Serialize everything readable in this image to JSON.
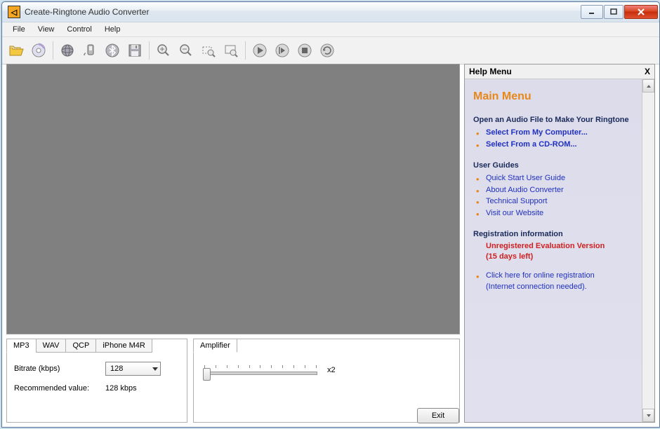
{
  "titlebar": {
    "title": "Create-Ringtone Audio Converter"
  },
  "menu": {
    "file": "File",
    "view": "View",
    "control": "Control",
    "help": "Help"
  },
  "tabs": {
    "mp3": "MP3",
    "wav": "WAV",
    "qcp": "QCP",
    "m4r": "iPhone M4R"
  },
  "bitrate": {
    "label": "Bitrate (kbps)",
    "value": "128",
    "rec_label": "Recommended value:",
    "rec_value": "128 kbps"
  },
  "amplifier": {
    "title": "Amplifier",
    "value": "x2"
  },
  "exit": "Exit",
  "help": {
    "title": "Help Menu",
    "main": "Main Menu",
    "open_h": "Open an Audio File to Make Your Ringtone",
    "open1": "Select From My Computer...",
    "open2": "Select From a CD-ROM...",
    "guides_h": "User Guides",
    "g1": "Quick Start User Guide",
    "g2": "About Audio Converter",
    "g3": "Technical Support",
    "g4": "Visit our Website",
    "reg_h": "Registration information",
    "reg_warn1": "Unregistered Evaluation Version",
    "reg_warn2": "(15 days left)",
    "reg_link1": "Click here for online registration",
    "reg_link2": "(Internet connection needed)."
  }
}
